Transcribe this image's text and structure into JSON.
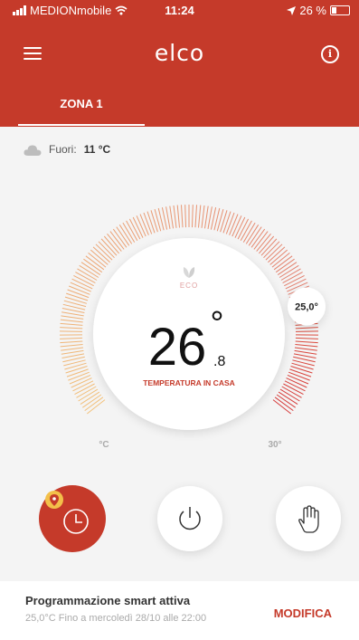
{
  "status_bar": {
    "carrier": "MEDIONmobile",
    "time": "11:24",
    "battery": "26 %",
    "battery_level": 0.26
  },
  "app": {
    "brand": "elco",
    "menu_icon": "hamburger-menu-icon",
    "info_icon": "info-icon"
  },
  "tabs": [
    {
      "label": "ZONA 1",
      "active": true
    }
  ],
  "outside": {
    "icon": "cloud-icon",
    "label": "Fuori:",
    "value": "11 °C"
  },
  "thermostat": {
    "eco_label": "ECO",
    "temperature_int": "26",
    "degree": "°",
    "temperature_dec": ".8",
    "caption": "TEMPERATURA IN CASA",
    "setpoint": "25,0°",
    "setpoint_value": 25.0,
    "scale_min": 5,
    "scale_max": 30,
    "min_label": "°C",
    "max_label": "30°"
  },
  "modes": [
    {
      "name": "schedule",
      "icon": "clock-icon",
      "badge_icon": "location-pin-icon",
      "active": true
    },
    {
      "name": "off",
      "icon": "power-icon",
      "active": false
    },
    {
      "name": "manual",
      "icon": "hand-icon",
      "active": false
    }
  ],
  "program": {
    "title": "Programmazione smart attiva",
    "subtitle": "25,0°C Fino a mercoledì 28/10 alle 22:00",
    "edit_label": "MODIFICA"
  },
  "colors": {
    "primary": "#c53a2a",
    "arc_start": "#f2b052",
    "arc_end": "#d63a3a",
    "accent_text": "#c53a2a"
  }
}
